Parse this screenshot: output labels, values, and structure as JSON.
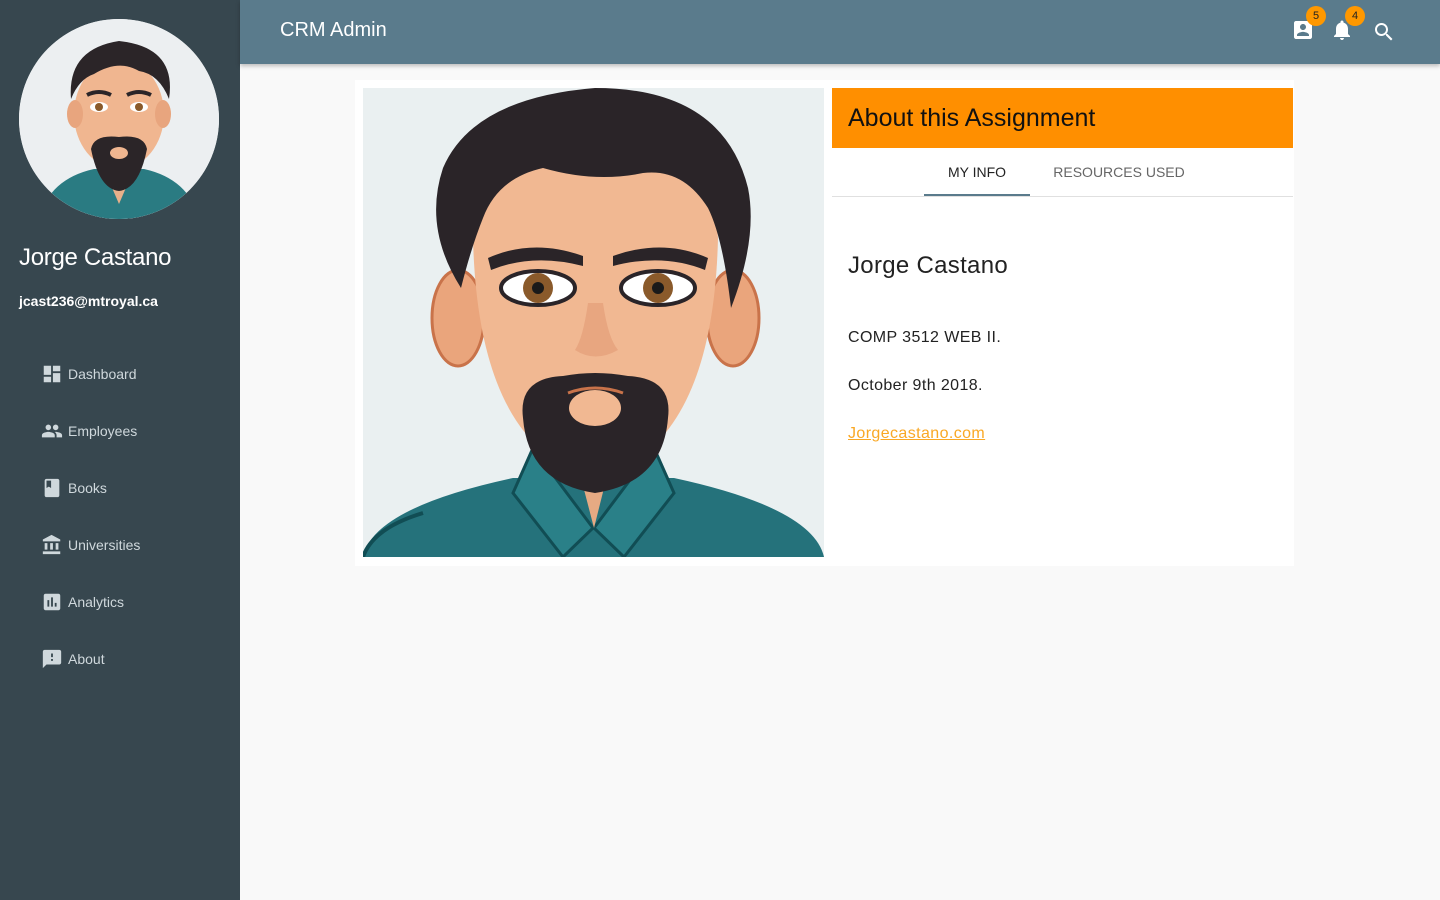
{
  "sidebar": {
    "user_name": "Jorge Castano",
    "user_email": "jcast236@mtroyal.ca",
    "items": [
      {
        "label": "Dashboard",
        "icon": "dashboard-icon"
      },
      {
        "label": "Employees",
        "icon": "people-icon"
      },
      {
        "label": "Books",
        "icon": "book-icon"
      },
      {
        "label": "Universities",
        "icon": "institution-icon"
      },
      {
        "label": "Analytics",
        "icon": "bar-chart-icon"
      },
      {
        "label": "About",
        "icon": "feedback-icon"
      }
    ]
  },
  "header": {
    "title": "CRM Admin",
    "contacts_badge": "5",
    "notifications_badge": "4"
  },
  "info": {
    "header_title": "About this Assignment",
    "tabs": [
      {
        "label": "MY INFO",
        "active": true
      },
      {
        "label": "RESOURCES USED",
        "active": false
      }
    ],
    "name": "Jorge Castano",
    "course": "COMP 3512 WEB II.",
    "date": "October 9th 2018.",
    "link_text": "Jorgecastano.com"
  },
  "colors": {
    "sidebar_bg": "#37474f",
    "header_bg": "#5a7b8c",
    "accent": "#ff8f00",
    "badge": "#ff9800",
    "link": "#f9a825"
  }
}
